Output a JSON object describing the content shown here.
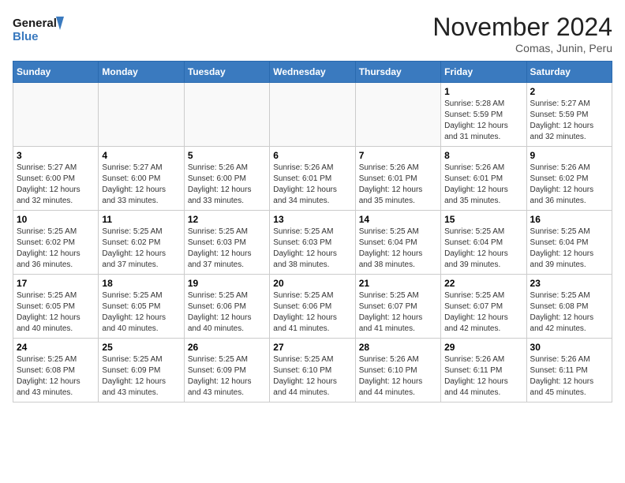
{
  "logo": {
    "line1": "General",
    "line2": "Blue"
  },
  "title": "November 2024",
  "subtitle": "Comas, Junin, Peru",
  "days_of_week": [
    "Sunday",
    "Monday",
    "Tuesday",
    "Wednesday",
    "Thursday",
    "Friday",
    "Saturday"
  ],
  "weeks": [
    [
      {
        "day": "",
        "info": ""
      },
      {
        "day": "",
        "info": ""
      },
      {
        "day": "",
        "info": ""
      },
      {
        "day": "",
        "info": ""
      },
      {
        "day": "",
        "info": ""
      },
      {
        "day": "1",
        "info": "Sunrise: 5:28 AM\nSunset: 5:59 PM\nDaylight: 12 hours\nand 31 minutes."
      },
      {
        "day": "2",
        "info": "Sunrise: 5:27 AM\nSunset: 5:59 PM\nDaylight: 12 hours\nand 32 minutes."
      }
    ],
    [
      {
        "day": "3",
        "info": "Sunrise: 5:27 AM\nSunset: 6:00 PM\nDaylight: 12 hours\nand 32 minutes."
      },
      {
        "day": "4",
        "info": "Sunrise: 5:27 AM\nSunset: 6:00 PM\nDaylight: 12 hours\nand 33 minutes."
      },
      {
        "day": "5",
        "info": "Sunrise: 5:26 AM\nSunset: 6:00 PM\nDaylight: 12 hours\nand 33 minutes."
      },
      {
        "day": "6",
        "info": "Sunrise: 5:26 AM\nSunset: 6:01 PM\nDaylight: 12 hours\nand 34 minutes."
      },
      {
        "day": "7",
        "info": "Sunrise: 5:26 AM\nSunset: 6:01 PM\nDaylight: 12 hours\nand 35 minutes."
      },
      {
        "day": "8",
        "info": "Sunrise: 5:26 AM\nSunset: 6:01 PM\nDaylight: 12 hours\nand 35 minutes."
      },
      {
        "day": "9",
        "info": "Sunrise: 5:26 AM\nSunset: 6:02 PM\nDaylight: 12 hours\nand 36 minutes."
      }
    ],
    [
      {
        "day": "10",
        "info": "Sunrise: 5:25 AM\nSunset: 6:02 PM\nDaylight: 12 hours\nand 36 minutes."
      },
      {
        "day": "11",
        "info": "Sunrise: 5:25 AM\nSunset: 6:02 PM\nDaylight: 12 hours\nand 37 minutes."
      },
      {
        "day": "12",
        "info": "Sunrise: 5:25 AM\nSunset: 6:03 PM\nDaylight: 12 hours\nand 37 minutes."
      },
      {
        "day": "13",
        "info": "Sunrise: 5:25 AM\nSunset: 6:03 PM\nDaylight: 12 hours\nand 38 minutes."
      },
      {
        "day": "14",
        "info": "Sunrise: 5:25 AM\nSunset: 6:04 PM\nDaylight: 12 hours\nand 38 minutes."
      },
      {
        "day": "15",
        "info": "Sunrise: 5:25 AM\nSunset: 6:04 PM\nDaylight: 12 hours\nand 39 minutes."
      },
      {
        "day": "16",
        "info": "Sunrise: 5:25 AM\nSunset: 6:04 PM\nDaylight: 12 hours\nand 39 minutes."
      }
    ],
    [
      {
        "day": "17",
        "info": "Sunrise: 5:25 AM\nSunset: 6:05 PM\nDaylight: 12 hours\nand 40 minutes."
      },
      {
        "day": "18",
        "info": "Sunrise: 5:25 AM\nSunset: 6:05 PM\nDaylight: 12 hours\nand 40 minutes."
      },
      {
        "day": "19",
        "info": "Sunrise: 5:25 AM\nSunset: 6:06 PM\nDaylight: 12 hours\nand 40 minutes."
      },
      {
        "day": "20",
        "info": "Sunrise: 5:25 AM\nSunset: 6:06 PM\nDaylight: 12 hours\nand 41 minutes."
      },
      {
        "day": "21",
        "info": "Sunrise: 5:25 AM\nSunset: 6:07 PM\nDaylight: 12 hours\nand 41 minutes."
      },
      {
        "day": "22",
        "info": "Sunrise: 5:25 AM\nSunset: 6:07 PM\nDaylight: 12 hours\nand 42 minutes."
      },
      {
        "day": "23",
        "info": "Sunrise: 5:25 AM\nSunset: 6:08 PM\nDaylight: 12 hours\nand 42 minutes."
      }
    ],
    [
      {
        "day": "24",
        "info": "Sunrise: 5:25 AM\nSunset: 6:08 PM\nDaylight: 12 hours\nand 43 minutes."
      },
      {
        "day": "25",
        "info": "Sunrise: 5:25 AM\nSunset: 6:09 PM\nDaylight: 12 hours\nand 43 minutes."
      },
      {
        "day": "26",
        "info": "Sunrise: 5:25 AM\nSunset: 6:09 PM\nDaylight: 12 hours\nand 43 minutes."
      },
      {
        "day": "27",
        "info": "Sunrise: 5:25 AM\nSunset: 6:10 PM\nDaylight: 12 hours\nand 44 minutes."
      },
      {
        "day": "28",
        "info": "Sunrise: 5:26 AM\nSunset: 6:10 PM\nDaylight: 12 hours\nand 44 minutes."
      },
      {
        "day": "29",
        "info": "Sunrise: 5:26 AM\nSunset: 6:11 PM\nDaylight: 12 hours\nand 44 minutes."
      },
      {
        "day": "30",
        "info": "Sunrise: 5:26 AM\nSunset: 6:11 PM\nDaylight: 12 hours\nand 45 minutes."
      }
    ]
  ]
}
